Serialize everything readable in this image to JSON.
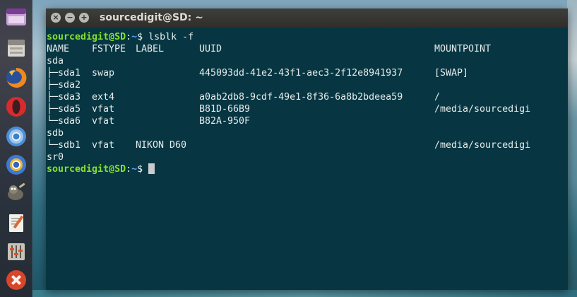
{
  "window": {
    "title": "sourcedigit@SD: ~",
    "buttons": {
      "close": "×",
      "minimize": "−",
      "maximize": "+"
    }
  },
  "prompt": {
    "user_host": "sourcedigit@SD",
    "separator": ":",
    "path": "~",
    "symbol": "$"
  },
  "terminal": {
    "command": "lsblk -f",
    "header": [
      "NAME",
      "FSTYPE",
      "LABEL",
      "UUID",
      "MOUNTPOINT"
    ],
    "rows": [
      {
        "name": "sda",
        "fstype": "",
        "label": "",
        "uuid": "",
        "mountpoint": ""
      },
      {
        "name": "├─sda1",
        "fstype": "swap",
        "label": "",
        "uuid": "445093dd-41e2-43f1-aec3-2f12e8941937",
        "mountpoint": "[SWAP]"
      },
      {
        "name": "├─sda2",
        "fstype": "",
        "label": "",
        "uuid": "",
        "mountpoint": ""
      },
      {
        "name": "├─sda3",
        "fstype": "ext4",
        "label": "",
        "uuid": "a0ab2db8-9cdf-49e1-8f36-6a8b2bdeea59",
        "mountpoint": "/"
      },
      {
        "name": "├─sda5",
        "fstype": "vfat",
        "label": "",
        "uuid": "B81D-66B9",
        "mountpoint": "/media/sourcedigi"
      },
      {
        "name": "└─sda6",
        "fstype": "vfat",
        "label": "",
        "uuid": "B82A-950F",
        "mountpoint": ""
      },
      {
        "name": "sdb",
        "fstype": "",
        "label": "",
        "uuid": "",
        "mountpoint": ""
      },
      {
        "name": "└─sdb1",
        "fstype": "vfat",
        "label": "NIKON D60",
        "uuid": "",
        "mountpoint": "/media/sourcedigi"
      },
      {
        "name": "sr0",
        "fstype": "",
        "label": "",
        "uuid": "",
        "mountpoint": ""
      }
    ]
  },
  "launcher": {
    "items": [
      {
        "icon": "dash-home-icon"
      },
      {
        "icon": "files-icon"
      },
      {
        "icon": "firefox-icon"
      },
      {
        "icon": "opera-icon"
      },
      {
        "icon": "chrome-icon"
      },
      {
        "icon": "chromium-icon"
      },
      {
        "icon": "gimp-icon"
      },
      {
        "icon": "text-editor-icon"
      },
      {
        "icon": "mixer-icon"
      },
      {
        "icon": "system-tools-icon"
      }
    ]
  },
  "colors": {
    "terminal_bg": "#073642",
    "prompt_user": "#85e227",
    "prompt_path": "#5aa3f0",
    "text": "#e6ecec"
  }
}
